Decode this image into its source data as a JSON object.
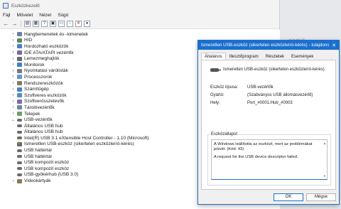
{
  "window": {
    "title": "Eszközkezelő"
  },
  "menu": [
    "Fájl",
    "Művelet",
    "Nézet",
    "Súgó"
  ],
  "tree": [
    {
      "level": 0,
      "expanded": false,
      "label": "Hangbemenetek és -kimenetek",
      "icon": "speaker-icon"
    },
    {
      "level": 0,
      "expanded": false,
      "label": "HID",
      "icon": "hid-icon"
    },
    {
      "level": 0,
      "expanded": false,
      "label": "Hordozható eszközök",
      "icon": "portable-device-icon"
    },
    {
      "level": 0,
      "expanded": false,
      "label": "IDE ATA/ATAPI vezérlők",
      "icon": "ide-controller-icon"
    },
    {
      "level": 0,
      "expanded": false,
      "label": "Lemezmeghajtók",
      "icon": "disk-drive-icon"
    },
    {
      "level": 0,
      "expanded": false,
      "label": "Monitorok",
      "icon": "monitor-icon"
    },
    {
      "level": 0,
      "expanded": false,
      "label": "Nyomtatási várólisták",
      "icon": "print-queue-icon"
    },
    {
      "level": 0,
      "expanded": false,
      "label": "Processzorok",
      "icon": "processor-icon"
    },
    {
      "level": 0,
      "expanded": false,
      "label": "Rendszereszközök",
      "icon": "system-device-icon"
    },
    {
      "level": 0,
      "expanded": false,
      "label": "Számítógép",
      "icon": "computer-icon"
    },
    {
      "level": 0,
      "expanded": false,
      "label": "Szoftveres eszközök",
      "icon": "software-device-icon"
    },
    {
      "level": 0,
      "expanded": false,
      "label": "Szoftverösszetevők",
      "icon": "software-component-icon"
    },
    {
      "level": 0,
      "expanded": false,
      "label": "Tárolóvezérlők",
      "icon": "storage-controller-icon"
    },
    {
      "level": 0,
      "expanded": false,
      "label": "Telepek",
      "icon": "battery-icon"
    },
    {
      "level": 0,
      "expanded": true,
      "label": "USB-vezérlők",
      "icon": "usb-icon"
    },
    {
      "level": 1,
      "label": "Általános USB hub",
      "icon": "usb-icon"
    },
    {
      "level": 1,
      "label": "Általános USB hub",
      "icon": "usb-icon"
    },
    {
      "level": 1,
      "label": "Intel(R) USB 3.1 eXtensible Host Controller - 1.10 (Microsoft)",
      "icon": "usb-icon"
    },
    {
      "level": 1,
      "label": "Ismeretlen USB-eszköz (sikertelen eszközleíró-kérés)",
      "icon": "usb-warning-icon",
      "warning": true
    },
    {
      "level": 1,
      "label": "USB háttértár",
      "icon": "usb-icon"
    },
    {
      "level": 1,
      "label": "USB háttértár",
      "icon": "usb-icon"
    },
    {
      "level": 1,
      "label": "USB kompozit eszköz",
      "icon": "usb-icon"
    },
    {
      "level": 1,
      "label": "USB kompozit eszköz",
      "icon": "usb-icon"
    },
    {
      "level": 1,
      "label": "USB-gyökérhub (USB 3.0)",
      "icon": "usb-icon"
    },
    {
      "level": 0,
      "expanded": false,
      "label": "Videokártyák",
      "icon": "display-adapter-icon"
    }
  ],
  "dialog": {
    "title": "Ismeretlen USB-eszköz (sikertelen eszközleíró-kérés) - tulajdonsá...",
    "tabs": [
      "Általános",
      "Illesztőprogram",
      "Részletek",
      "Események"
    ],
    "device_name": "Ismeretlen USB-eszköz (sikertelen eszközleíró-kérés)",
    "props": [
      {
        "key": "Eszköz típusa:",
        "value": "USB-vezérlők"
      },
      {
        "key": "Gyártó:",
        "value": "(Szabványos USB állomásvezérlő)"
      },
      {
        "key": "Hely:",
        "value": "Port_#0001.Hub_#0003"
      }
    ],
    "status_label": "Eszközállapot",
    "status_line1": "A Windows leállította az eszközt, mert az problémákat jelzett. (Kód: 43)",
    "status_line2": "A request for the USB device descriptor failed.",
    "ok_label": "OK",
    "cancel_label": "Mégse"
  },
  "background_ghost_text": "eszkö"
}
